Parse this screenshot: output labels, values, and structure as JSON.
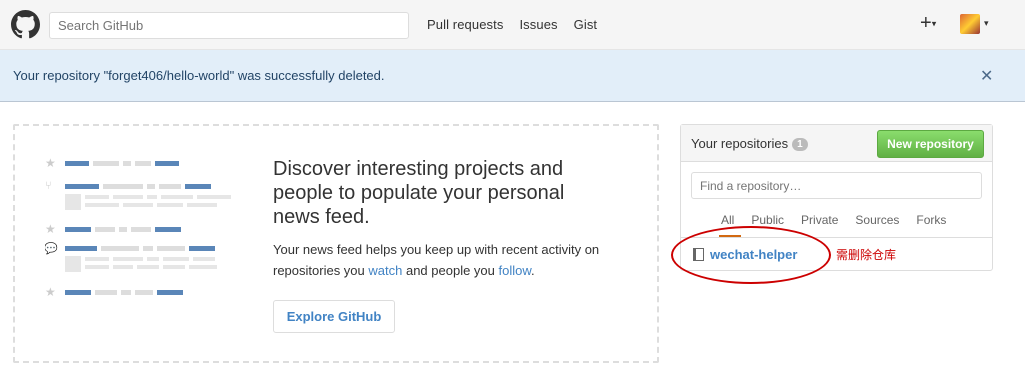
{
  "header": {
    "search_placeholder": "Search GitHub",
    "nav": [
      "Pull requests",
      "Issues",
      "Gist"
    ],
    "plus_label": "+",
    "caret": "▾"
  },
  "flash": {
    "message": "Your repository \"forget406/hello-world\" was successfully deleted.",
    "close": "✕"
  },
  "discover": {
    "title": "Discover interesting projects and people to populate your personal news feed.",
    "text_before_watch": "Your news feed helps you keep up with recent activity on repositories you ",
    "watch_link": "watch",
    "text_between": " and people you ",
    "follow_link": "follow",
    "text_end": ".",
    "explore_button": "Explore GitHub"
  },
  "repos": {
    "title": "Your repositories",
    "count": "1",
    "new_button": "New repository",
    "filter_placeholder": "Find a repository…",
    "tabs": [
      "All",
      "Public",
      "Private",
      "Sources",
      "Forks"
    ],
    "items": [
      "wechat-helper"
    ]
  },
  "annotation": {
    "text": "需删除仓库"
  },
  "colors": {
    "link": "#4183c4",
    "flash_bg": "#e2eef9",
    "new_repo_green": "#60b044",
    "annotation_red": "#cc0000"
  }
}
